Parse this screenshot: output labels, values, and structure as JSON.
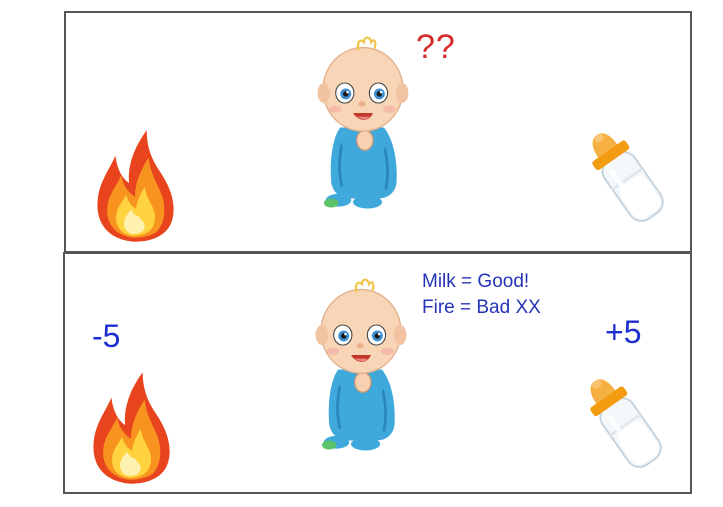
{
  "top_panel": {
    "question": "??"
  },
  "bottom_panel": {
    "rule_milk": "Milk = Good!",
    "rule_fire": "Fire = Bad XX",
    "fire_reward": "-5",
    "milk_reward": "+5"
  },
  "icons": [
    "fire-icon",
    "baby-icon",
    "milk-bottle-icon"
  ],
  "colors": {
    "question": "#d42a2a",
    "rules": "#2633b8",
    "rewards": "#1f2fcf",
    "border": "#555555"
  }
}
